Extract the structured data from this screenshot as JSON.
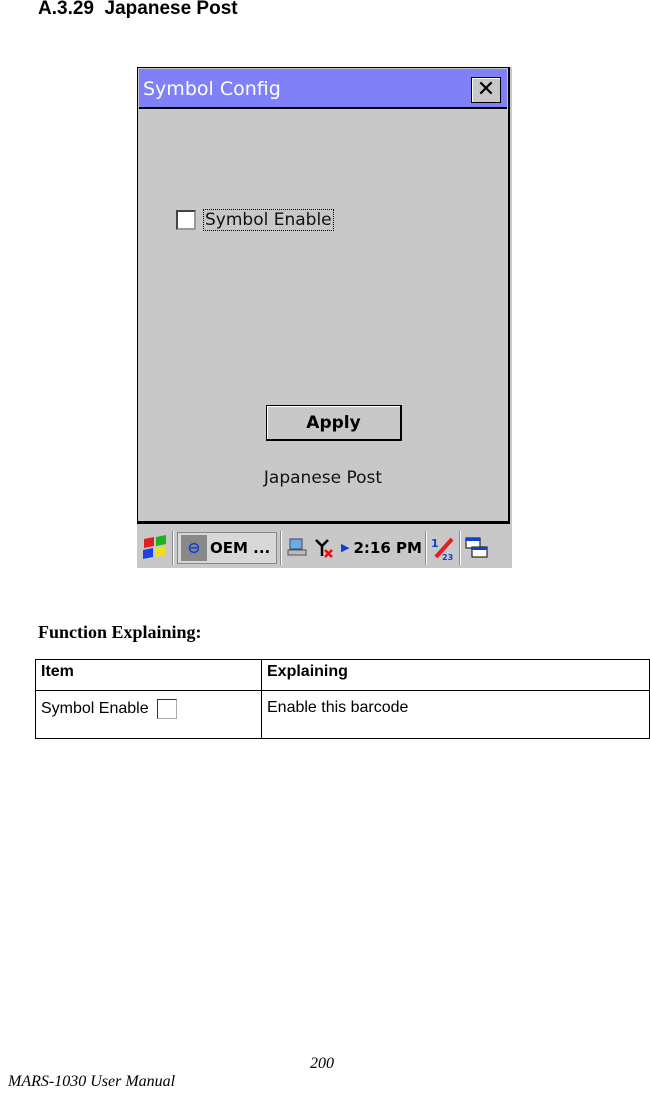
{
  "heading": "A.3.29  Japanese Post",
  "dialog": {
    "title": "Symbol Config",
    "close_glyph": "✕",
    "checkbox_label": "Symbol Enable",
    "checkbox_checked": false,
    "apply_label": "Apply",
    "caption": "Japanese Post"
  },
  "taskbar": {
    "task_label": "OEM ...",
    "clock": "2:16 PM",
    "icons": [
      "windows-start-icon",
      "oem-app-icon",
      "network-icon",
      "signal-off-icon",
      "arrow-right-icon",
      "input-panel-icon",
      "window-switch-icon"
    ]
  },
  "function_explaining": {
    "title": "Function Explaining:",
    "headers": [
      "Item",
      "Explaining"
    ],
    "rows": [
      {
        "item": "Symbol Enable",
        "explaining": "Enable this barcode"
      }
    ]
  },
  "footer": {
    "manual": "MARS-1030 User Manual",
    "page": "200"
  }
}
